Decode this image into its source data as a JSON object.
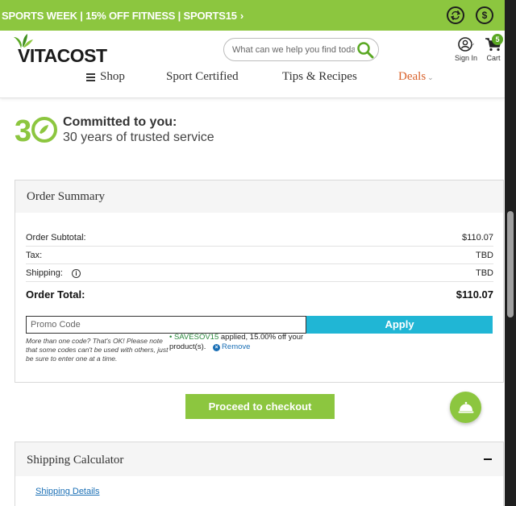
{
  "promo_bar": {
    "text": "SPORTS WEEK | 15% OFF FITNESS | SPORTS15",
    "chevron": "›",
    "icons": [
      "reorder-icon",
      "dollar-icon"
    ],
    "color": "#8cc63f"
  },
  "header": {
    "logo_text": "VITACOST",
    "search": {
      "placeholder": "What can we help you find today?"
    },
    "signin_label": "Sign In",
    "cart_label": "Cart",
    "cart_count": "5"
  },
  "nav": {
    "shop": "Shop",
    "sport": "Sport Certified",
    "tips": "Tips & Recipes",
    "deals": "Deals"
  },
  "commitment": {
    "title": "Committed to you:",
    "subtitle": "30 years of trusted service"
  },
  "order_summary": {
    "title": "Order Summary",
    "rows": [
      {
        "label": "Order Subtotal:",
        "value": "$110.07"
      },
      {
        "label": "Tax:",
        "value": "TBD"
      },
      {
        "label": "Shipping:",
        "value": "TBD"
      }
    ],
    "total": {
      "label": "Order Total:",
      "value": "$110.07"
    },
    "promo_placeholder": "Promo Code",
    "apply_label": "Apply",
    "note": "More than one code? That's OK! Please note that some codes can't be used with others, just be sure to enter one at a time.",
    "applied_code": "• SAVESOV15",
    "applied_text": " applied, 15.00% off your product(s).",
    "remove_label": "Remove"
  },
  "checkout": {
    "label": "Proceed to checkout"
  },
  "shipping_calculator": {
    "title": "Shipping Calculator",
    "link": "Shipping Details"
  },
  "colors": {
    "green": "#8cc63f",
    "blue": "#20b6d5",
    "deals": "#d9612a"
  }
}
